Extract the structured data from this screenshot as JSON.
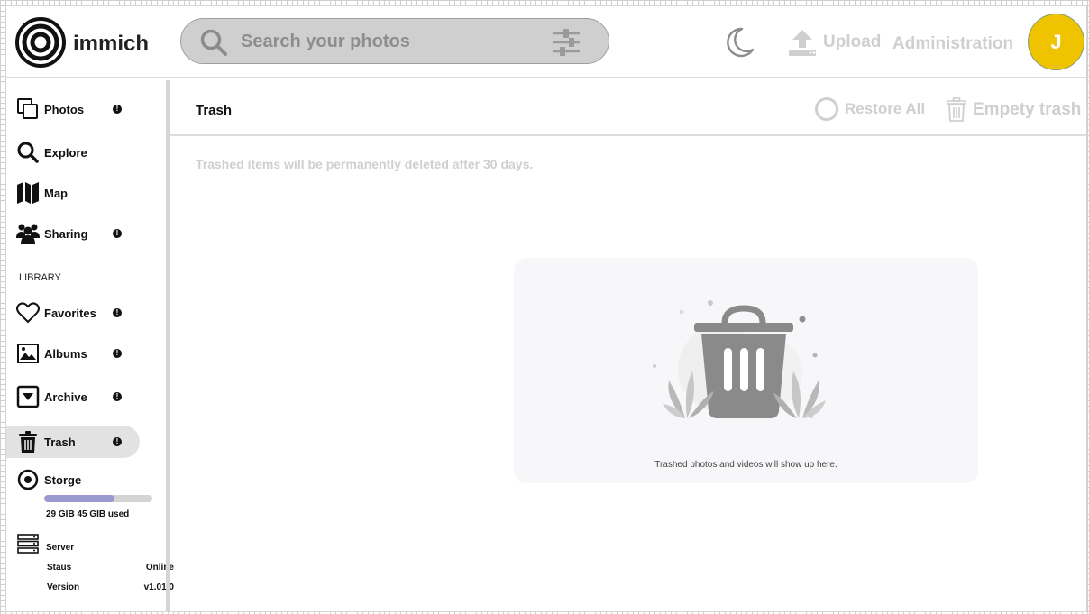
{
  "header": {
    "logo_text": "immich",
    "search_placeholder": "Search your photos",
    "upload_label": "Upload",
    "admin_label": "Administration",
    "avatar_initial": "J"
  },
  "sidebar": {
    "items": [
      {
        "label": "Photos",
        "icon": "photos-icon",
        "badge": true
      },
      {
        "label": "Explore",
        "icon": "search-icon",
        "badge": false
      },
      {
        "label": "Map",
        "icon": "map-icon",
        "badge": false
      },
      {
        "label": "Sharing",
        "icon": "people-icon",
        "badge": true
      }
    ],
    "library_label": "LIBRARY",
    "library_items": [
      {
        "label": "Favorites",
        "icon": "heart-icon",
        "badge": true
      },
      {
        "label": "Albums",
        "icon": "image-icon",
        "badge": true
      },
      {
        "label": "Archive",
        "icon": "archive-icon",
        "badge": true
      },
      {
        "label": "Trash",
        "icon": "trash-icon",
        "badge": true,
        "active": true
      }
    ],
    "badge_glyph": "!",
    "storage": {
      "label": "Storge",
      "usage_text": "29 GIB 45 GIB used",
      "used_fraction": 0.65
    },
    "server": {
      "label": "Server",
      "status_key": "Staus",
      "status_value": "Online",
      "version_key": "Version",
      "version_value": "v1.01.0"
    }
  },
  "main": {
    "title": "Trash",
    "restore_label": "Restore All",
    "empty_label": "Empety trash",
    "notice": "Trashed items will be permanently deleted after 30 days.",
    "empty_state_text": "Trashed photos and videos will show up here."
  },
  "colors": {
    "avatar": "#f0c300",
    "disabled_text": "#cfcfcf",
    "storage_fill": "#9a9ad1"
  }
}
